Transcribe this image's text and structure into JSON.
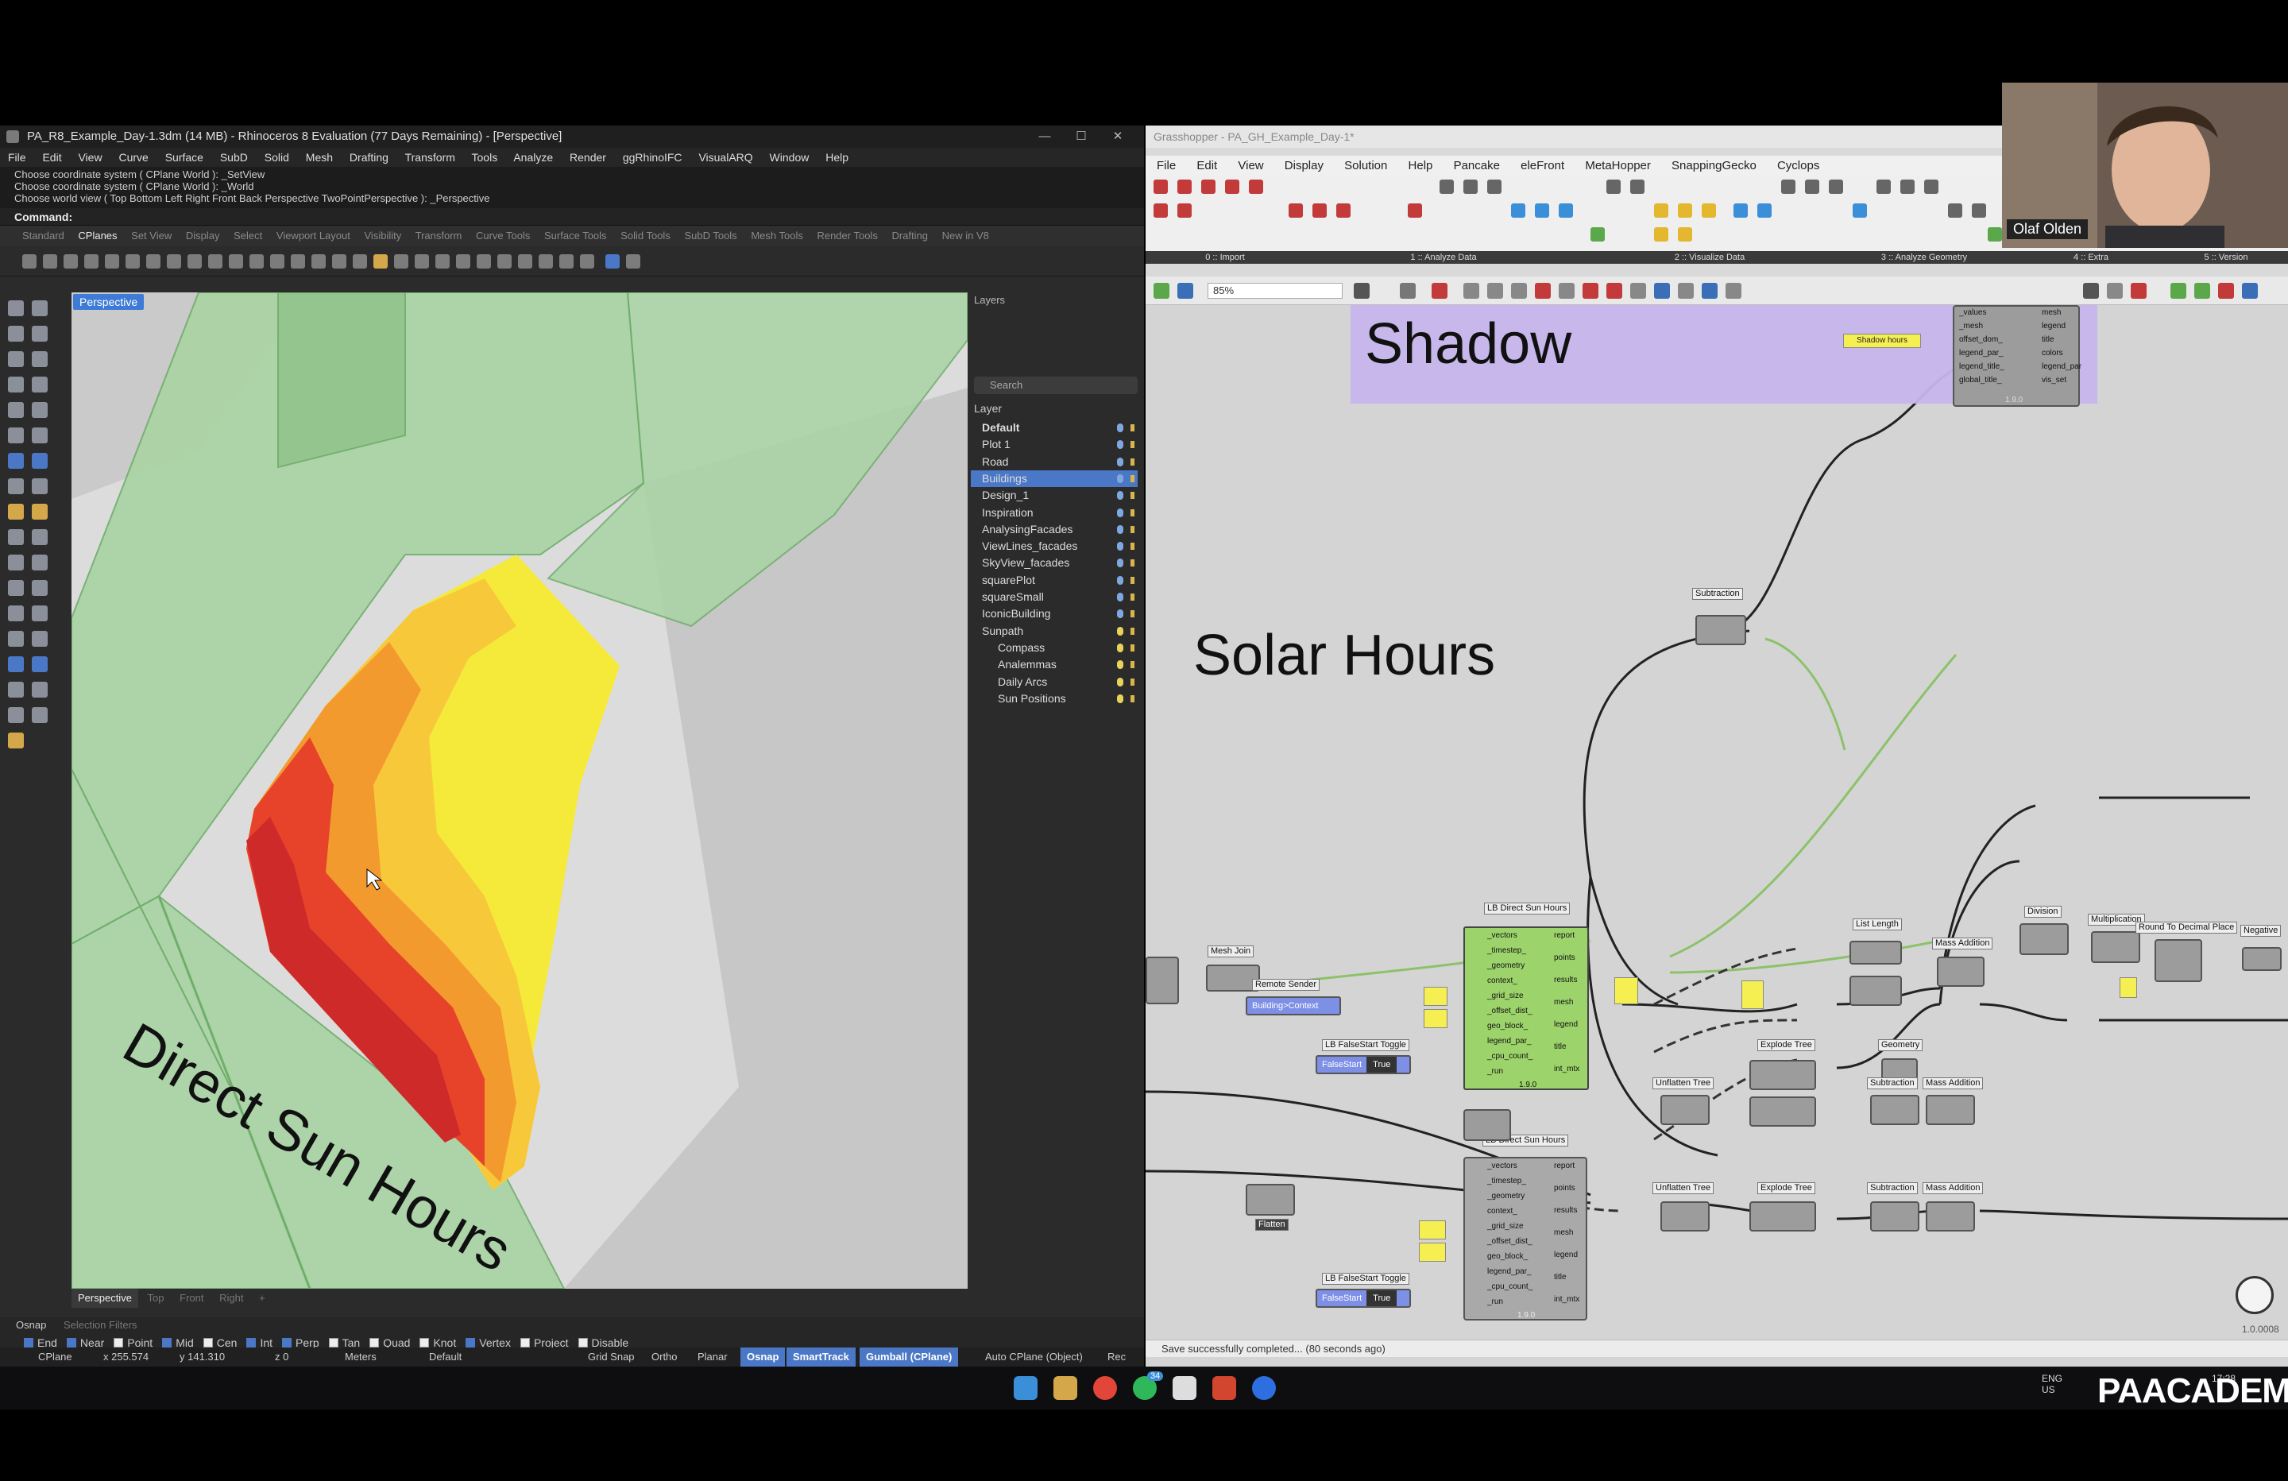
{
  "rhino": {
    "title": "PA_R8_Example_Day-1.3dm (14 MB) - Rhinoceros 8 Evaluation (77 Days Remaining) - [Perspective]",
    "menu": [
      "File",
      "Edit",
      "View",
      "Curve",
      "Surface",
      "SubD",
      "Solid",
      "Mesh",
      "Drafting",
      "Transform",
      "Tools",
      "Analyze",
      "Render",
      "ggRhinoIFC",
      "VisualARQ",
      "Window",
      "Help"
    ],
    "command_history": [
      "Choose coordinate system ( CPlane World ): _SetView",
      "Choose coordinate system ( CPlane World ): _World",
      "Choose world view ( Top Bottom Left Right Front Back Perspective TwoPointPerspective ): _Perspective"
    ],
    "command_label": "Command:",
    "tabs": [
      "Standard",
      "CPlanes",
      "Set View",
      "Display",
      "Select",
      "Viewport Layout",
      "Visibility",
      "Transform",
      "Curve Tools",
      "Surface Tools",
      "Solid Tools",
      "SubD Tools",
      "Mesh Tools",
      "Render Tools",
      "Drafting",
      "New in V8"
    ],
    "active_tab": "CPlanes",
    "viewport_label": "Perspective",
    "viewport_text": "Direct Sun Hours",
    "viewport_tabs": [
      "Perspective",
      "Top",
      "Front",
      "Right",
      "+"
    ],
    "layers": {
      "panel_title": "Layers",
      "search_placeholder": "Search",
      "column_header": "Layer",
      "items": [
        {
          "name": "Default",
          "bold": true
        },
        {
          "name": "Plot 1"
        },
        {
          "name": "Road"
        },
        {
          "name": "Buildings",
          "selected": true
        },
        {
          "name": "Design_1"
        },
        {
          "name": "Inspiration"
        },
        {
          "name": "AnalysingFacades"
        },
        {
          "name": "ViewLines_facades"
        },
        {
          "name": "SkyView_facades"
        },
        {
          "name": "squarePlot"
        },
        {
          "name": "squareSmall"
        },
        {
          "name": "IconicBuilding"
        },
        {
          "name": "Sunpath"
        },
        {
          "name": "Compass"
        },
        {
          "name": "Analemmas"
        },
        {
          "name": "Daily Arcs"
        },
        {
          "name": "Sun Positions"
        }
      ]
    },
    "osnap_tabs": [
      "Osnap",
      "Selection Filters"
    ],
    "osnap_items": [
      {
        "label": "End",
        "on": true
      },
      {
        "label": "Near",
        "on": true
      },
      {
        "label": "Point",
        "on": false
      },
      {
        "label": "Mid",
        "on": true
      },
      {
        "label": "Cen",
        "on": false
      },
      {
        "label": "Int",
        "on": true
      },
      {
        "label": "Perp",
        "on": true
      },
      {
        "label": "Tan",
        "on": false
      },
      {
        "label": "Quad",
        "on": false
      },
      {
        "label": "Knot",
        "on": false
      },
      {
        "label": "Vertex",
        "on": true
      },
      {
        "label": "Project",
        "on": false
      },
      {
        "label": "Disable",
        "on": false
      }
    ],
    "status": {
      "cplane": "CPlane",
      "x": "x 255.574",
      "y": "y 141.310",
      "z": "z 0",
      "units": "Meters",
      "layer": "Default",
      "grid_snap": "Grid Snap",
      "ortho": "Ortho",
      "planar": "Planar",
      "osnap": "Osnap",
      "smarttrack": "SmartTrack",
      "gumball": "Gumball (CPlane)",
      "autocplane": "Auto CPlane (Object)",
      "rec": "Rec"
    }
  },
  "grasshopper": {
    "title": "Grasshopper - PA_GH_Example_Day-1*",
    "menu": [
      "File",
      "Edit",
      "View",
      "Display",
      "Solution",
      "Help",
      "Pancake",
      "eleFront",
      "MetaHopper",
      "SnappingGecko",
      "Cyclops"
    ],
    "ribbon_groups": [
      "0 :: Import",
      "1 :: Analyze Data",
      "2 :: Visualize Data",
      "3 :: Analyze Geometry",
      "4 :: Extra",
      "5 :: Version"
    ],
    "zoom": "85%",
    "groups": {
      "shadow": "Shadow",
      "solar": "Solar Hours"
    },
    "components": {
      "subtraction": "Subtraction",
      "mesh_join": "Mesh Join",
      "remote_sender": "Remote Sender",
      "building_context": "Building>Context",
      "lb_direct_sun": "LB Direct Sun Hours",
      "lb_direct_sun_2": "LB Direct Sun Hours",
      "lb_falsestart": "LB FalseStart Toggle",
      "falsestart": "FalseStart",
      "true_label": "True",
      "list_length": "List Length",
      "mass_addition": "Mass Addition",
      "division": "Division",
      "multiplication": "Multiplication",
      "round": "Round To Decimal Place",
      "negative": "Negative",
      "explode_tree": "Explode Tree",
      "geometry": "Geometry",
      "unflatten_tree": "Unflatten Tree",
      "flatten": "Flatten",
      "shadow_hours": "Shadow hours",
      "version": "1.9.0"
    },
    "lb_inputs": [
      "_vectors",
      "_timestep_",
      "_geometry",
      "context_",
      "_grid_size",
      "_offset_dist_",
      "geo_block_",
      "legend_par_",
      "_cpu_count_",
      "_run"
    ],
    "lb_outputs": [
      "report",
      "points",
      "results",
      "mesh",
      "legend",
      "title",
      "int_mtx"
    ],
    "recolor_inputs": [
      "_values",
      "_mesh",
      "offset_dom_",
      "legend_par_",
      "legend_title_",
      "global_title_"
    ],
    "recolor_outputs": [
      "mesh",
      "legend",
      "title",
      "colors",
      "legend_par",
      "vis_set"
    ],
    "status": "Save successfully completed... (80 seconds ago)",
    "corner_value": "1.0.0008"
  },
  "webcam": {
    "name": "Olaf Olden"
  },
  "taskbar": {
    "lang1": "ENG",
    "lang2": "US",
    "time": "17:28",
    "badge": "34"
  },
  "brand": "PAACADEMY"
}
